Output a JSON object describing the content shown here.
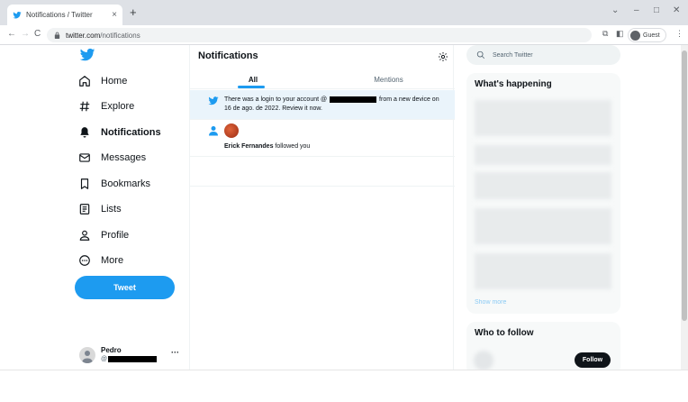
{
  "browser": {
    "tab_title": "Notifications / Twitter",
    "tab_close": "×",
    "new_tab": "+",
    "url_host": "twitter.com",
    "url_path": "/notifications",
    "profile_label": "Guest",
    "controls": {
      "dropdown": "⌄",
      "minimize": "–",
      "maximize": "□",
      "close": "✕",
      "menu": "⋮"
    },
    "nav": {
      "back": "←",
      "forward": "→",
      "reload": "C"
    }
  },
  "sidebar": {
    "items": [
      {
        "label": "Home",
        "icon": "home-icon"
      },
      {
        "label": "Explore",
        "icon": "hashtag-icon"
      },
      {
        "label": "Notifications",
        "icon": "bell-icon",
        "active": true
      },
      {
        "label": "Messages",
        "icon": "envelope-icon"
      },
      {
        "label": "Bookmarks",
        "icon": "bookmark-icon"
      },
      {
        "label": "Lists",
        "icon": "list-icon"
      },
      {
        "label": "Profile",
        "icon": "person-icon"
      },
      {
        "label": "More",
        "icon": "more-circle-icon"
      }
    ],
    "tweet_label": "Tweet",
    "account": {
      "name": "Pedro",
      "handle_prefix": "@",
      "more": "···"
    }
  },
  "main": {
    "title": "Notifications",
    "tabs": [
      {
        "label": "All",
        "selected": true
      },
      {
        "label": "Mentions",
        "selected": false
      }
    ],
    "notifications": [
      {
        "type": "login",
        "text_before": "There was a login to your account @",
        "text_after": " from a new device on 16 de ago. de 2022. Review it now."
      },
      {
        "type": "follow",
        "user": "Erick Fernandes",
        "action": " followed you"
      }
    ]
  },
  "right": {
    "search_placeholder": "Search Twitter",
    "trends_title": "What's happening",
    "show_more": "Show more",
    "who_to_follow_title": "Who to follow",
    "follow_label": "Follow"
  },
  "colors": {
    "accent": "#1d9bf0",
    "highlight_bg": "#eaf4fb",
    "text": "#0f1419",
    "muted": "#536471"
  }
}
